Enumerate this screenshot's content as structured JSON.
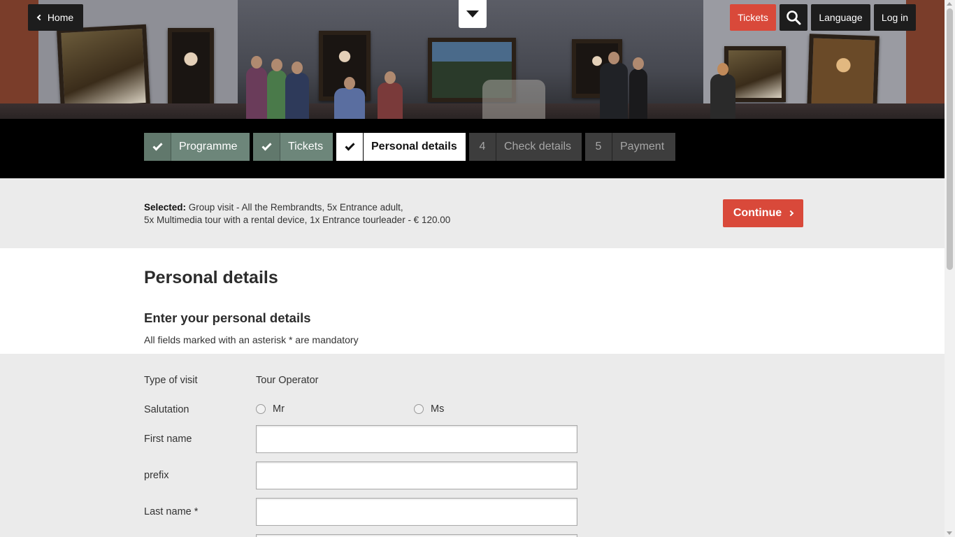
{
  "nav": {
    "home_label": "Home",
    "tickets_label": "Tickets",
    "language_label": "Language",
    "login_label": "Log in"
  },
  "steps": [
    {
      "number": "",
      "label": "Programme",
      "state": "done"
    },
    {
      "number": "",
      "label": "Tickets",
      "state": "done"
    },
    {
      "number": "",
      "label": "Personal details",
      "state": "active"
    },
    {
      "number": "4",
      "label": "Check details",
      "state": "todo"
    },
    {
      "number": "5",
      "label": "Payment",
      "state": "todo"
    }
  ],
  "summary": {
    "prefix": "Selected:",
    "line1": " Group visit - All the Rembrandts, 5x Entrance adult,",
    "line2": "5x Multimedia tour with a rental device, 1x Entrance tourleader - € 120.00",
    "continue_label": "Continue"
  },
  "page": {
    "title": "Personal details",
    "subtitle": "Enter your personal details",
    "mandatory_note": "All fields marked with an asterisk * are mandatory"
  },
  "form": {
    "visit_type_label": "Type of visit",
    "visit_type_value": "Tour Operator",
    "salutation_label": "Salutation",
    "salutation_options": [
      "Mr",
      "Ms"
    ],
    "first_name_label": "First name",
    "first_name_value": "",
    "prefix_label": "prefix",
    "prefix_value": "",
    "last_name_label": "Last name *",
    "last_name_value": ""
  },
  "colors": {
    "accent_red": "#d9493a",
    "step_done": "#6d867a",
    "step_todo": "#3d3d3d",
    "steps_bar": "#000000"
  },
  "icons": {
    "home_chevron": "chevron-left-icon",
    "menu": "triangle-down-icon",
    "search": "search-icon",
    "step_done": "check-icon",
    "continue": "chevron-right-icon"
  }
}
